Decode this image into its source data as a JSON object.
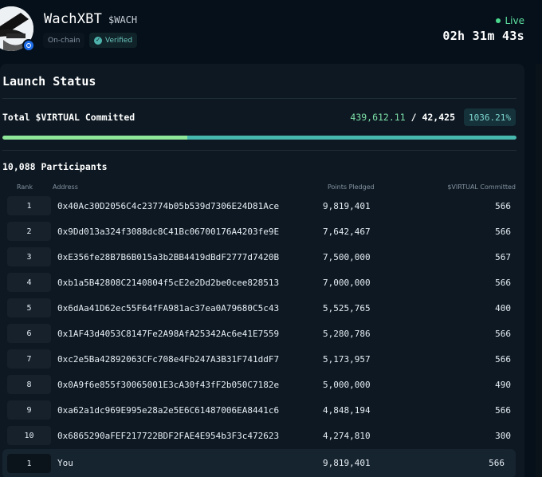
{
  "header": {
    "name": "WachXBT",
    "ticker": "$WACH",
    "tag_onchain": "On-chain",
    "tag_verified": "Verified",
    "live_label": "Live",
    "countdown": "02h 31m 43s"
  },
  "launch": {
    "title": "Launch Status",
    "committed_label": "Total $VIRTUAL Committed",
    "committed_current": "439,612.11",
    "committed_separator": "/",
    "committed_target": "42,425",
    "percent": "1036.21%",
    "progress_fraction": 1.0
  },
  "participants": {
    "title": "10,088 Participants",
    "columns": {
      "rank": "Rank",
      "address": "Address",
      "points": "Points Pledged",
      "committed": "$VIRTUAL Committed"
    },
    "rows": [
      {
        "rank": "1",
        "address": "0x40Ac30D2056C4c23774b05b539d7306E24D81Ace",
        "points": "9,819,401",
        "committed": "566"
      },
      {
        "rank": "2",
        "address": "0x9Dd013a324f3088dc8C41Bc06700176A4203fe9E",
        "points": "7,642,467",
        "committed": "566"
      },
      {
        "rank": "3",
        "address": "0xE356fe28B7B6B015a3b2BB4419dBdF2777d7420B",
        "points": "7,500,000",
        "committed": "567"
      },
      {
        "rank": "4",
        "address": "0xb1a5B42808C2140804f5cE2e2Dd2be0cee828513",
        "points": "7,000,000",
        "committed": "566"
      },
      {
        "rank": "5",
        "address": "0x6dAa41D62ec55F64fFA981ac37ea0A79680C5c43",
        "points": "5,525,765",
        "committed": "400"
      },
      {
        "rank": "6",
        "address": "0x1AF43d4053C8147Fe2A98AfA25342Ac6e41E7559",
        "points": "5,280,786",
        "committed": "566"
      },
      {
        "rank": "7",
        "address": "0xc2e5Ba42892063CFc708e4Fb247A3B31F741ddF7",
        "points": "5,173,957",
        "committed": "566"
      },
      {
        "rank": "8",
        "address": "0x0A9f6e855f30065001E3cA30f43fF2b050C7182e",
        "points": "5,000,000",
        "committed": "490"
      },
      {
        "rank": "9",
        "address": "0xa62a1dc969E995e28a2e5E6C61487006EA8441c6",
        "points": "4,848,194",
        "committed": "566"
      },
      {
        "rank": "10",
        "address": "0x6865290aFEF217722BDF2FAE4E954b3F3c472623",
        "points": "4,274,810",
        "committed": "300"
      }
    ],
    "you": {
      "rank": "1",
      "label": "You",
      "points": "9,819,401",
      "committed": "566"
    }
  },
  "colors": {
    "accent_green": "#7fe0a8",
    "accent_teal": "#47b8ae",
    "live_green": "#4ad98d"
  }
}
